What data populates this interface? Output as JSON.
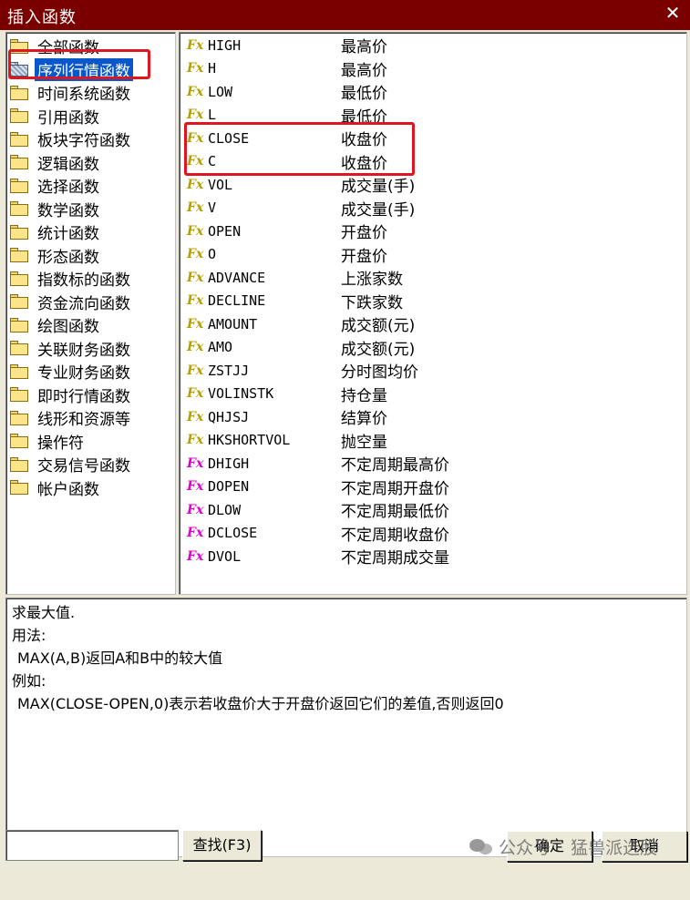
{
  "window": {
    "title": "插入函数",
    "close_glyph": "✕"
  },
  "categories": [
    {
      "label": "全部函数"
    },
    {
      "label": "序列行情函数",
      "selected": true
    },
    {
      "label": "时间系统函数"
    },
    {
      "label": "引用函数"
    },
    {
      "label": "板块字符函数"
    },
    {
      "label": "逻辑函数"
    },
    {
      "label": "选择函数"
    },
    {
      "label": "数学函数"
    },
    {
      "label": "统计函数"
    },
    {
      "label": "形态函数"
    },
    {
      "label": "指数标的函数"
    },
    {
      "label": "资金流向函数"
    },
    {
      "label": "绘图函数"
    },
    {
      "label": "关联财务函数"
    },
    {
      "label": "专业财务函数"
    },
    {
      "label": "即时行情函数"
    },
    {
      "label": "线形和资源等"
    },
    {
      "label": "操作符"
    },
    {
      "label": "交易信号函数"
    },
    {
      "label": "帐户函数"
    }
  ],
  "functions": [
    {
      "icon": "Fx",
      "name": "HIGH",
      "desc": "最高价",
      "icon_color": "#b5a000"
    },
    {
      "icon": "Fx",
      "name": "H",
      "desc": "最高价",
      "icon_color": "#b5a000"
    },
    {
      "icon": "Fx",
      "name": "LOW",
      "desc": "最低价",
      "icon_color": "#b5a000"
    },
    {
      "icon": "Fx",
      "name": "L",
      "desc": "最低价",
      "icon_color": "#b5a000"
    },
    {
      "icon": "Fx",
      "name": "CLOSE",
      "desc": "收盘价",
      "icon_color": "#b5a000"
    },
    {
      "icon": "Fx",
      "name": "C",
      "desc": "收盘价",
      "icon_color": "#b5a000"
    },
    {
      "icon": "Fx",
      "name": "VOL",
      "desc": "成交量(手)",
      "icon_color": "#b5a000"
    },
    {
      "icon": "Fx",
      "name": "V",
      "desc": "成交量(手)",
      "icon_color": "#b5a000"
    },
    {
      "icon": "Fx",
      "name": "OPEN",
      "desc": "开盘价",
      "icon_color": "#b5a000"
    },
    {
      "icon": "Fx",
      "name": "O",
      "desc": "开盘价",
      "icon_color": "#b5a000"
    },
    {
      "icon": "Fx",
      "name": "ADVANCE",
      "desc": "上涨家数",
      "icon_color": "#b5a000"
    },
    {
      "icon": "Fx",
      "name": "DECLINE",
      "desc": "下跌家数",
      "icon_color": "#b5a000"
    },
    {
      "icon": "Fx",
      "name": "AMOUNT",
      "desc": "成交额(元)",
      "icon_color": "#b5a000"
    },
    {
      "icon": "Fx",
      "name": "AMO",
      "desc": "成交额(元)",
      "icon_color": "#b5a000"
    },
    {
      "icon": "Fx",
      "name": "ZSTJJ",
      "desc": "分时图均价",
      "icon_color": "#b5a000"
    },
    {
      "icon": "Fx",
      "name": "VOLINSTK",
      "desc": "持仓量",
      "icon_color": "#b5a000"
    },
    {
      "icon": "Fx",
      "name": "QHJSJ",
      "desc": "结算价",
      "icon_color": "#b5a000"
    },
    {
      "icon": "Fx",
      "name": "HKSHORTVOL",
      "desc": "抛空量",
      "icon_color": "#b5a000"
    },
    {
      "icon": "Fx",
      "name": "DHIGH",
      "desc": "不定周期最高价",
      "icon_color": "#e000d0"
    },
    {
      "icon": "Fx",
      "name": "DOPEN",
      "desc": "不定周期开盘价",
      "icon_color": "#e000d0"
    },
    {
      "icon": "Fx",
      "name": "DLOW",
      "desc": "不定周期最低价",
      "icon_color": "#e000d0"
    },
    {
      "icon": "Fx",
      "name": "DCLOSE",
      "desc": "不定周期收盘价",
      "icon_color": "#e000d0"
    },
    {
      "icon": "Fx",
      "name": "DVOL",
      "desc": "不定周期成交量",
      "icon_color": "#e000d0"
    }
  ],
  "description": {
    "summary": "求最大值.",
    "usage_label": "用法:",
    "usage": "MAX(A,B)返回A和B中的较大值",
    "example_label": "例如:",
    "example": "MAX(CLOSE-OPEN,0)表示若收盘价大于开盘价返回它们的差值,否则返回0"
  },
  "search": {
    "value": "",
    "find_button": "查找(F3)"
  },
  "buttons": {
    "ok": "确定",
    "cancel": "取消"
  },
  "watermark": {
    "prefix": "公众号",
    "separator": "·",
    "name": "猛兽派选股"
  },
  "highlight_color": "#e0151f"
}
